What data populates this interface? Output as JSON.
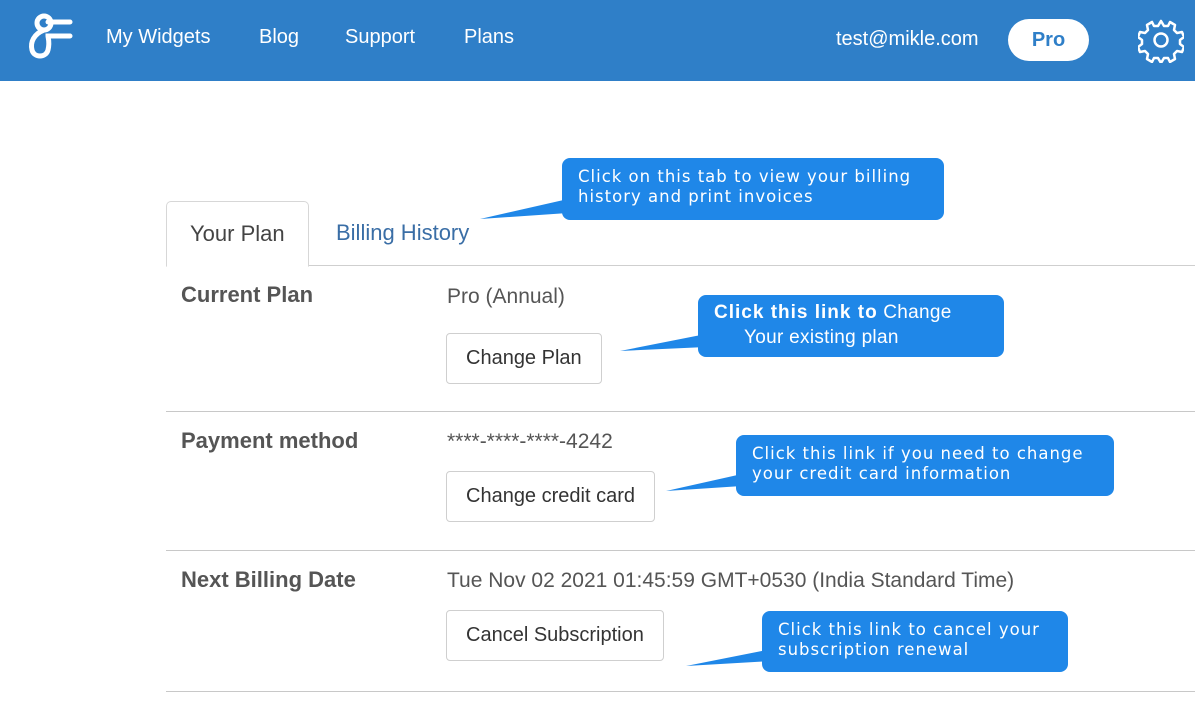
{
  "navbar": {
    "background": "#2f7fc8",
    "logo_icon": "brand-logo-icon",
    "links": [
      {
        "label": "My Widgets"
      },
      {
        "label": "Blog"
      },
      {
        "label": "Support"
      },
      {
        "label": "Plans"
      }
    ],
    "user_email": "test@mikle.com",
    "plan_badge": "Pro",
    "settings_icon": "gear-icon"
  },
  "tabs": [
    {
      "label": "Your Plan",
      "active": true
    },
    {
      "label": "Billing History",
      "active": false
    }
  ],
  "rows": [
    {
      "label": "Current Plan",
      "value": "Pro (Annual)",
      "button": "Change Plan"
    },
    {
      "label": "Payment method",
      "value": "****-****-****-4242",
      "button": "Change credit card"
    },
    {
      "label": "Next Billing Date",
      "value": "Tue Nov 02 2021 01:45:59 GMT+0530 (India Standard Time)",
      "button": "Cancel Subscription"
    }
  ],
  "callouts": {
    "billing_history": {
      "lines": [
        "Click on this tab to view your billing",
        "history and print invoices"
      ]
    },
    "change_plan": {
      "bold_part": "Click this link to",
      "rest_part": " Change",
      "line2": "Your existing plan"
    },
    "change_card": {
      "lines": [
        "Click this link if you need to change",
        "your credit card information"
      ]
    },
    "cancel_subscription": {
      "lines": [
        "Click this link to cancel your",
        "subscription renewal"
      ]
    }
  },
  "colors": {
    "accent": "#2f7fc8",
    "callout": "#1f87e8",
    "tab_link": "#3a6ea6"
  }
}
